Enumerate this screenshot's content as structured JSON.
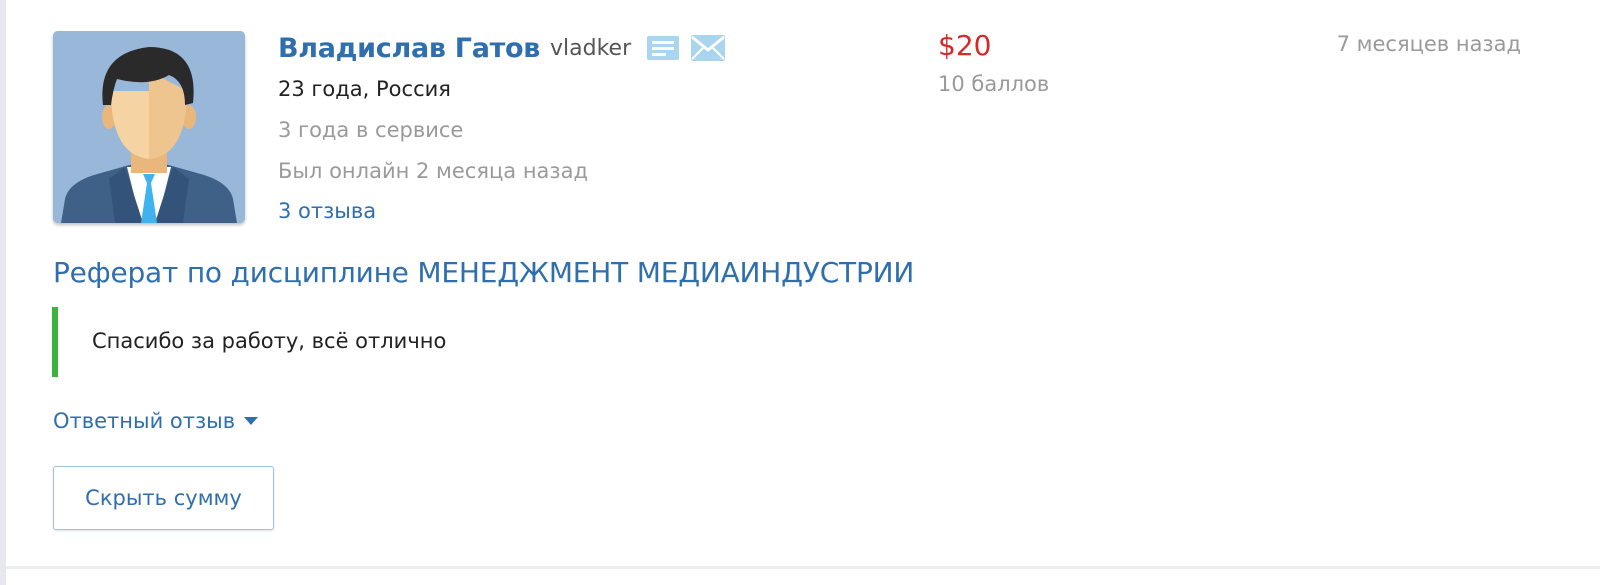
{
  "review": {
    "user": {
      "name": "Владислав Гатов",
      "login": "vladker",
      "age_country": "23 года, Россия",
      "service_time": "3 года в сервисе",
      "last_online": "Был онлайн 2 месяца назад",
      "reviews_link": "3 отзыва"
    },
    "icons": {
      "avatar": "avatar-businessman",
      "profile": "document-icon",
      "message": "mail-icon",
      "reply_toggle": "caret-down-icon"
    },
    "price": "$20",
    "points": "10 баллов",
    "time_ago": "7 месяцев назад",
    "work_title": "Реферат по дисциплине МЕНЕДЖМЕНТ МЕДИАИНДУСТРИИ",
    "comment": "Спасибо за работу, всё отлично",
    "reply_toggle_label": "Ответный отзыв",
    "hide_amount_button": "Скрыть сумму"
  },
  "colors": {
    "link": "#2f6fad",
    "price": "#d42a2a",
    "muted": "#9a9a9a",
    "quote_border": "#3cb33c",
    "icon": "#a9d6ee",
    "avatar_bg": "#99b7d8"
  }
}
